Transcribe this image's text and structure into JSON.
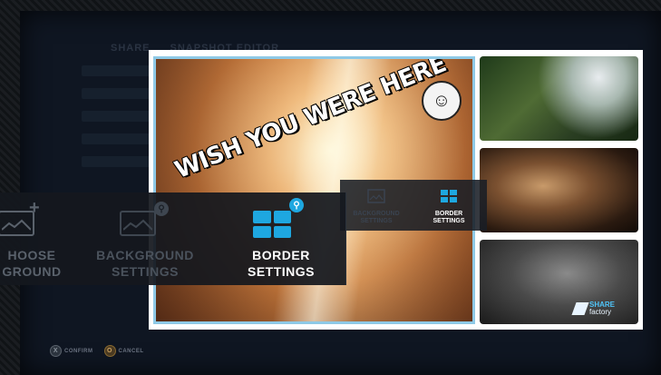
{
  "background_header": {
    "left": "SHARE",
    "right": "SNAPSHOT EDITOR"
  },
  "main_photo": {
    "caption": "WISH YOU WERE HERE"
  },
  "watermark": {
    "brand": "SHARE",
    "sub": "factory"
  },
  "toolbar": {
    "buttons": [
      {
        "id": "choose-background",
        "label_line1": "HOOSE",
        "label_line2": "GROUND",
        "state": "partial"
      },
      {
        "id": "background-settings",
        "label_line1": "BACKGROUND",
        "label_line2": "SETTINGS",
        "state": "disabled"
      },
      {
        "id": "border-settings",
        "label_line1": "BORDER",
        "label_line2": "SETTINGS",
        "state": "active"
      }
    ]
  },
  "small_toolbar": {
    "buttons": [
      {
        "label_line1": "BACKGROUND",
        "label_line2": "SETTINGS",
        "state": "disabled"
      },
      {
        "label_line1": "BORDER",
        "label_line2": "SETTINGS",
        "state": "active"
      }
    ]
  },
  "footer": {
    "confirm": "CONFIRM",
    "confirm_key": "X",
    "cancel": "CANCEL",
    "cancel_key": "O"
  },
  "colors": {
    "accent": "#1ea7e0",
    "frame": "#8ec9e6",
    "panel": "#14181e"
  }
}
